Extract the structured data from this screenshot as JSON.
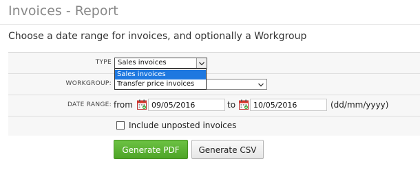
{
  "page": {
    "title": "Invoices - Report",
    "subtitle": "Choose a date range for invoices, and optionally a Workgroup"
  },
  "form": {
    "type": {
      "label": "TYPE",
      "selected": "Sales invoices",
      "options": [
        "Sales invoices",
        "Transfer price invoices"
      ],
      "highlighted_option": "Sales invoices",
      "dropdown_open": true
    },
    "workgroup": {
      "label": "WORKGROUP:",
      "selected": ""
    },
    "date_range": {
      "label": "DATE RANGE:",
      "from_word": "from",
      "from_value": "09/05/2016",
      "to_word": "to",
      "to_value": "10/05/2016",
      "format_hint": "(dd/mm/yyyy)"
    },
    "include_unposted": {
      "label": "Include unposted invoices",
      "checked": false
    }
  },
  "buttons": {
    "generate_pdf": "Generate PDF",
    "generate_csv": "Generate CSV"
  },
  "colors": {
    "pdf_button": "#59b431",
    "dropdown_highlight": "#1e78e0",
    "form_background": "#f7f7f7",
    "title_text": "#888888"
  },
  "icons": {
    "date_from": "calendar-icon",
    "date_to": "calendar-icon",
    "select_arrow": "chevron-down-icon"
  }
}
